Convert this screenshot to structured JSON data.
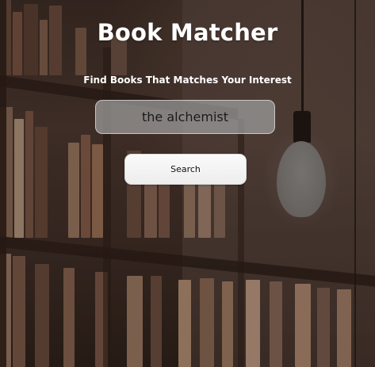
{
  "app": {
    "title": "Book Matcher",
    "subtitle": "Find Books That Matches Your Interest"
  },
  "search": {
    "value": "the alchemist",
    "button_label": "Search"
  },
  "background": {
    "description_icon": "bookshelf-background",
    "lamp_icon": "light-bulb-icon"
  },
  "colors": {
    "text": "#ffffff",
    "input_bg": "#a0a0a0",
    "button_bg": "#f2f2f2"
  }
}
